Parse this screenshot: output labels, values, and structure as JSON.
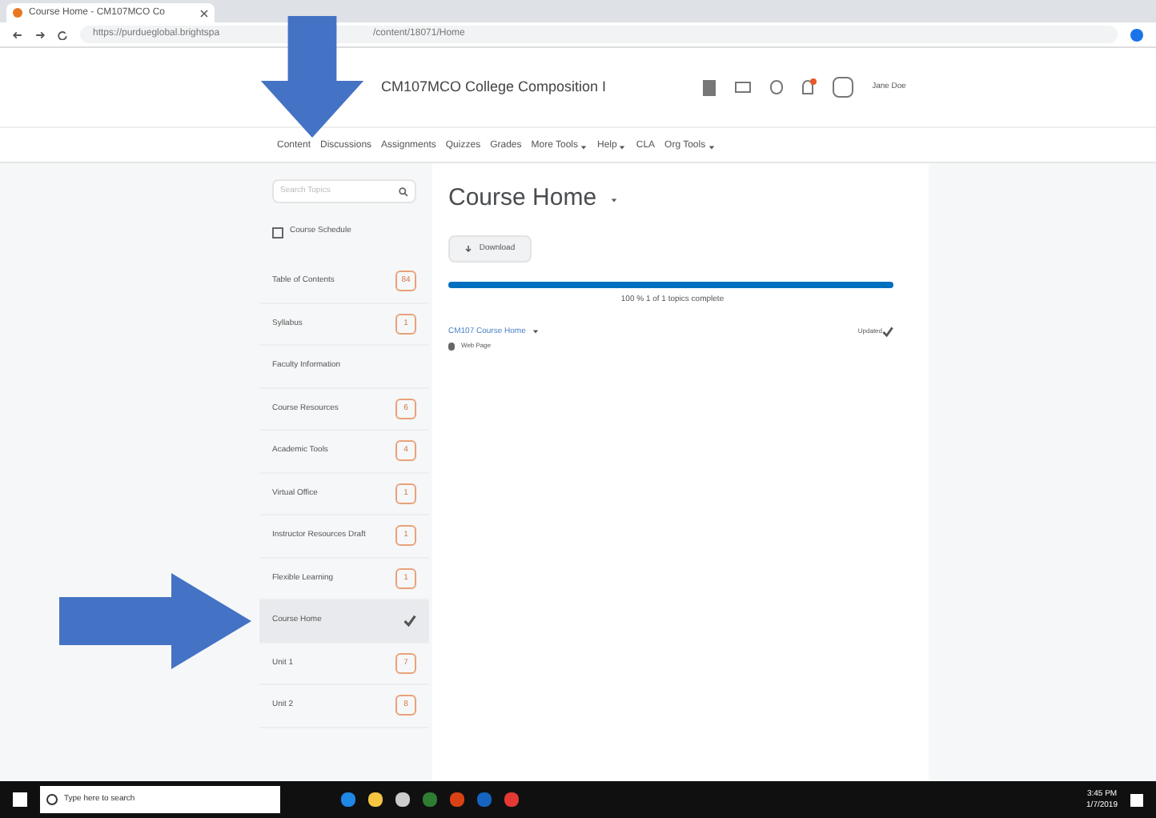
{
  "browser": {
    "tab_title": "Course Home - CM107MCO Co",
    "url_start": "https://purdueglobal.brightspa",
    "url_end": "/content/18071/Home"
  },
  "header": {
    "course_title": "CM107MCO College Composition I",
    "user": "Jane Doe"
  },
  "nav": [
    {
      "label": "Content",
      "menu": false
    },
    {
      "label": "Discussions",
      "menu": false
    },
    {
      "label": "Assignments",
      "menu": false
    },
    {
      "label": "Quizzes",
      "menu": false
    },
    {
      "label": "Grades",
      "menu": false
    },
    {
      "label": "More Tools",
      "menu": true
    },
    {
      "label": "Help",
      "menu": true
    },
    {
      "label": "CLA",
      "menu": false
    },
    {
      "label": "Org Tools",
      "menu": true
    }
  ],
  "sidebar": {
    "search": {
      "placeholder": "Search Topics"
    },
    "schedule": "Course Schedule",
    "items": [
      {
        "label": "Table of Contents",
        "badge": "84",
        "selected": false
      },
      {
        "label": "Syllabus",
        "badge": "1",
        "selected": false
      },
      {
        "label": "Faculty Information",
        "selected": false
      },
      {
        "label": "Course Resources",
        "badge": "6",
        "selected": false
      },
      {
        "label": "Academic Tools",
        "badge": "4",
        "selected": false
      },
      {
        "label": "Virtual Office",
        "badge": "1",
        "selected": false
      },
      {
        "label": "Instructor Resources Draft",
        "badge": "1",
        "selected": false
      },
      {
        "label": "Flexible Learning",
        "badge": "1",
        "selected": false
      },
      {
        "label": "Course Home",
        "selected": true
      },
      {
        "label": "Unit 1",
        "badge": "7",
        "selected": false
      },
      {
        "label": "Unit 2",
        "badge": "8",
        "selected": false
      }
    ]
  },
  "main": {
    "title": "Course Home",
    "download": "Download",
    "progress": {
      "level": 1,
      "text": "100 % 1 of 1 topics complete"
    },
    "topic": {
      "title": "CM107 Course Home",
      "type": "Web Page",
      "status": "Updated",
      "completed": true
    }
  },
  "taskbar": {
    "search_placeholder": "Type here to search",
    "time": "3:45 PM",
    "date": "1/7/2019"
  }
}
